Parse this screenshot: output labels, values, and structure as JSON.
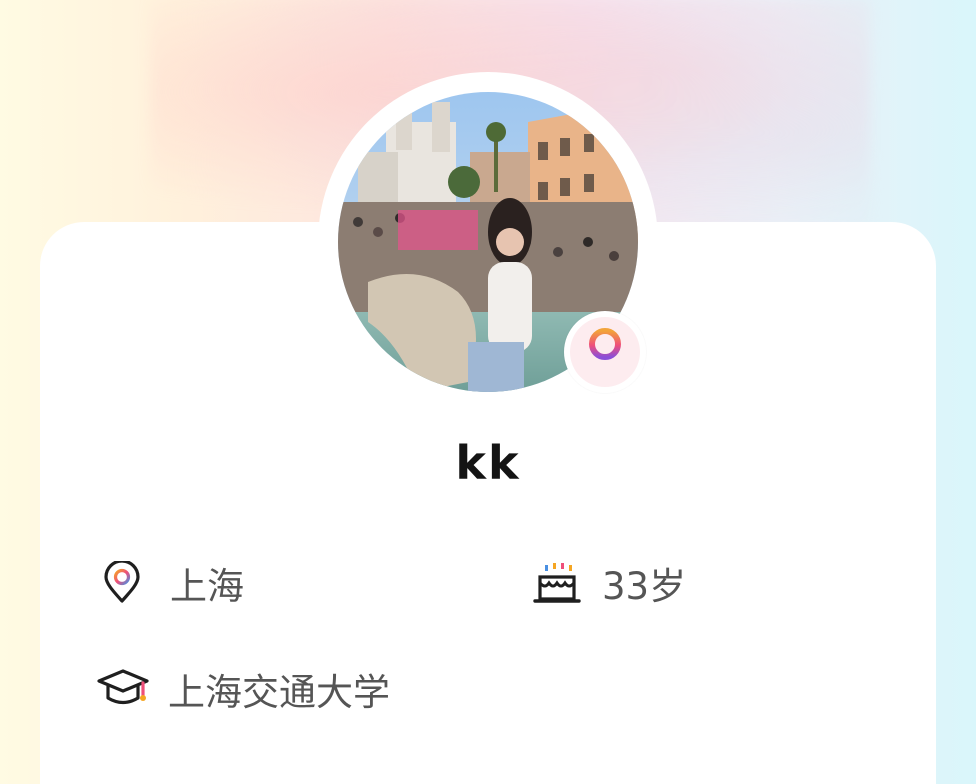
{
  "profile": {
    "nickname": "kk",
    "avatar": {
      "alt": "avatar photo",
      "icon": "avatar-photo"
    },
    "gender": {
      "value": "female",
      "icon": "female-symbol-icon"
    },
    "location": {
      "icon": "location-pin-icon",
      "text": "上海"
    },
    "age": {
      "icon": "birthday-cake-icon",
      "text": "33岁"
    },
    "school": {
      "icon": "graduation-cap-icon",
      "text": "上海交通大学"
    }
  },
  "colors": {
    "female_gradient_start": "#f2a33a",
    "female_gradient_mid": "#ef4f7a",
    "female_gradient_end": "#8b4fd8",
    "badge_background": "#fdecef",
    "text_primary": "#141414",
    "text_secondary": "#555555"
  }
}
